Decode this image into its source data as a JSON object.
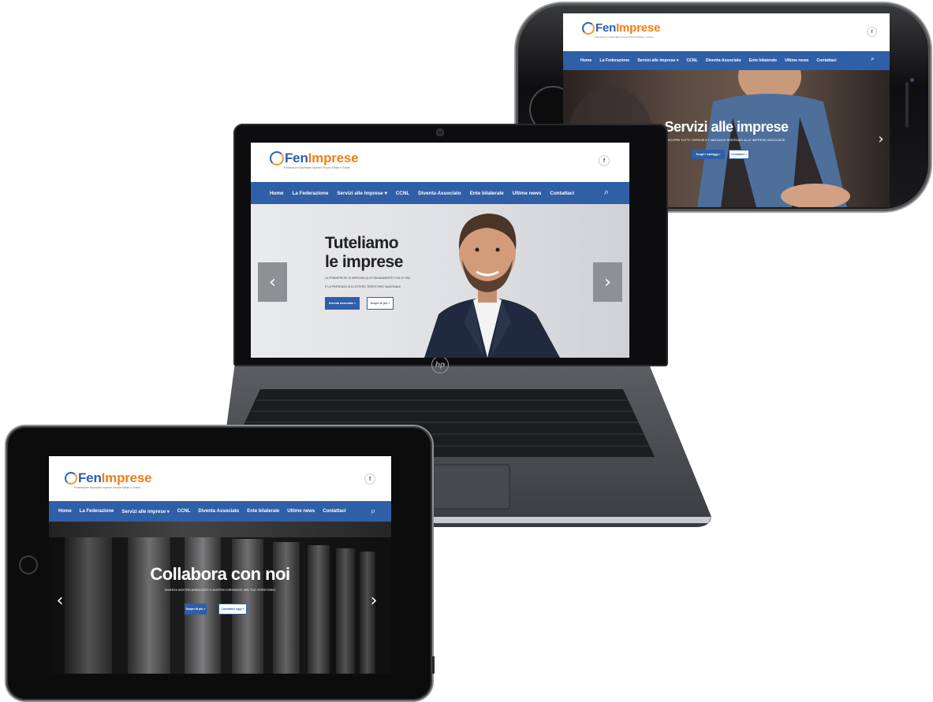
{
  "site": {
    "logo_fen": "Fen",
    "logo_imprese": "Imprese",
    "logo_tagline": "Federazione Nazionale Imprese Piccole Medie e Grandi",
    "facebook_glyph": "f",
    "search_icon": "search-icon",
    "nav": {
      "home": "Home",
      "federazione": "La Federazione",
      "servizi": "Servizi alle imprese",
      "servizi_caret": "▾",
      "ccnl": "CCNL",
      "diventa": "Diventa Associato",
      "ente": "Ente bilaterale",
      "news": "Ultime news",
      "contattaci": "Contattaci"
    }
  },
  "laptop": {
    "brand": "hp",
    "slide": {
      "title_line1": "Tuteliamo",
      "title_line2": "le imprese",
      "subtitle_line1": "LA FENIMPRESE SI IMPEGNA QUOTIDIANAMENTE CON LE PMI",
      "subtitle_line2": "E LA PRESENZA SULL'INTERO TERRITORIO NAZIONALE",
      "btn_primary": "Diventa Associato »",
      "btn_secondary": "Scopri di più »",
      "prev": "‹",
      "next": "›"
    }
  },
  "phone": {
    "slide": {
      "title": "Servizi alle imprese",
      "subtitle": "SCOPRI TUTTI I SERVIZI E I VANTAGGI RISERVATI ALLE IMPRESE ASSOCIATE",
      "btn_primary": "Scopri i vantaggi »",
      "btn_secondary": "Contattaci »",
      "next": "›"
    }
  },
  "tablet": {
    "slide": {
      "title": "Collabora con noi",
      "subtitle": "DIVENTA NOSTRO ASSOCIATO O NOSTRO DIRIGENTE NEL TUO TERRITORIO",
      "btn_primary": "Scopri di più »",
      "btn_secondary": "Contattaci oggi »",
      "prev": "‹",
      "next": "›"
    }
  }
}
